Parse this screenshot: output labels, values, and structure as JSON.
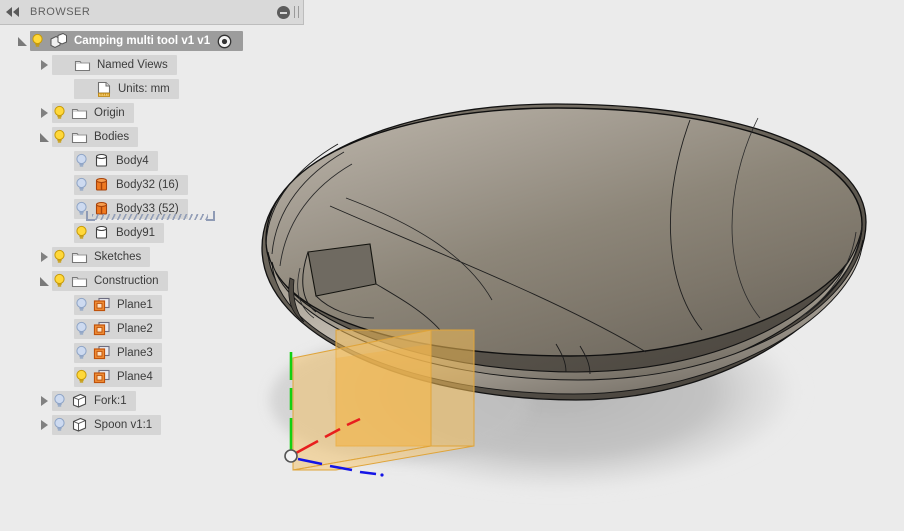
{
  "window": {
    "background_color": "#ebebeb"
  },
  "browser": {
    "title": "BROWSER",
    "collapse_icon": "double-left-arrow-icon",
    "minimize_icon": "minus-circle-icon",
    "grip_icon": "panel-grip-icon"
  },
  "tree": {
    "items": [
      {
        "label": "Camping multi tool v1 v1",
        "indent": 0,
        "expander": "open",
        "bulb": "on",
        "icon": "component-icon",
        "selected": true,
        "activate_icon": "activate-component-icon"
      },
      {
        "label": "Named Views",
        "indent": 1,
        "expander": "closed",
        "bulb": "none",
        "icon": "folder-icon",
        "selected": false
      },
      {
        "label": "Units: mm",
        "indent": 2,
        "expander": "none",
        "bulb": "none",
        "icon": "units-document-icon",
        "selected": false
      },
      {
        "label": "Origin",
        "indent": 1,
        "expander": "closed",
        "bulb": "on",
        "icon": "folder-icon",
        "selected": false
      },
      {
        "label": "Bodies",
        "indent": 1,
        "expander": "open",
        "bulb": "on",
        "icon": "folder-icon",
        "selected": false
      },
      {
        "label": "Body4",
        "indent": 2,
        "expander": "none",
        "bulb": "off",
        "icon": "body-grey-icon",
        "selected": false
      },
      {
        "label": "Body32 (16)",
        "indent": 2,
        "expander": "none",
        "bulb": "off",
        "icon": "body-orange-icon",
        "selected": false
      },
      {
        "label": "Body33 (52)",
        "indent": 2,
        "expander": "none",
        "bulb": "off",
        "icon": "body-orange-icon",
        "selected": false,
        "drag_hatch": true
      },
      {
        "label": "Body91",
        "indent": 2,
        "expander": "none",
        "bulb": "on",
        "icon": "body-grey-icon",
        "selected": false
      },
      {
        "label": "Sketches",
        "indent": 1,
        "expander": "closed",
        "bulb": "on",
        "icon": "folder-icon",
        "selected": false
      },
      {
        "label": "Construction",
        "indent": 1,
        "expander": "open",
        "bulb": "on",
        "icon": "folder-icon",
        "selected": false
      },
      {
        "label": "Plane1",
        "indent": 2,
        "expander": "none",
        "bulb": "off",
        "icon": "plane-icon",
        "selected": false
      },
      {
        "label": "Plane2",
        "indent": 2,
        "expander": "none",
        "bulb": "off",
        "icon": "plane-icon",
        "selected": false
      },
      {
        "label": "Plane3",
        "indent": 2,
        "expander": "none",
        "bulb": "off",
        "icon": "plane-icon",
        "selected": false
      },
      {
        "label": "Plane4",
        "indent": 2,
        "expander": "none",
        "bulb": "on",
        "icon": "plane-icon",
        "selected": false
      },
      {
        "label": "Fork:1",
        "indent": 1,
        "expander": "closed",
        "bulb": "off",
        "icon": "component-cube-icon",
        "selected": false
      },
      {
        "label": "Spoon v1:1",
        "indent": 1,
        "expander": "closed",
        "bulb": "off",
        "icon": "component-cube-icon",
        "selected": false
      }
    ]
  },
  "viewport": {
    "model_name": "bowl-body",
    "surface_color": "#8a8377",
    "surface_highlight": "#a9a298",
    "surface_shadow": "#6c665d",
    "edge_color": "#1a1a1a",
    "ground_shadow_color": "#bcbcbc",
    "origin": {
      "x_axis_color": "#e81e1e",
      "y_axis_color": "#1414e6",
      "z_axis_color": "#12d012",
      "origin_marker": "origin-point-icon"
    },
    "construction_planes": {
      "fill_color": "#f2b84b",
      "edge_color": "#d99a2b",
      "count": 3
    }
  }
}
